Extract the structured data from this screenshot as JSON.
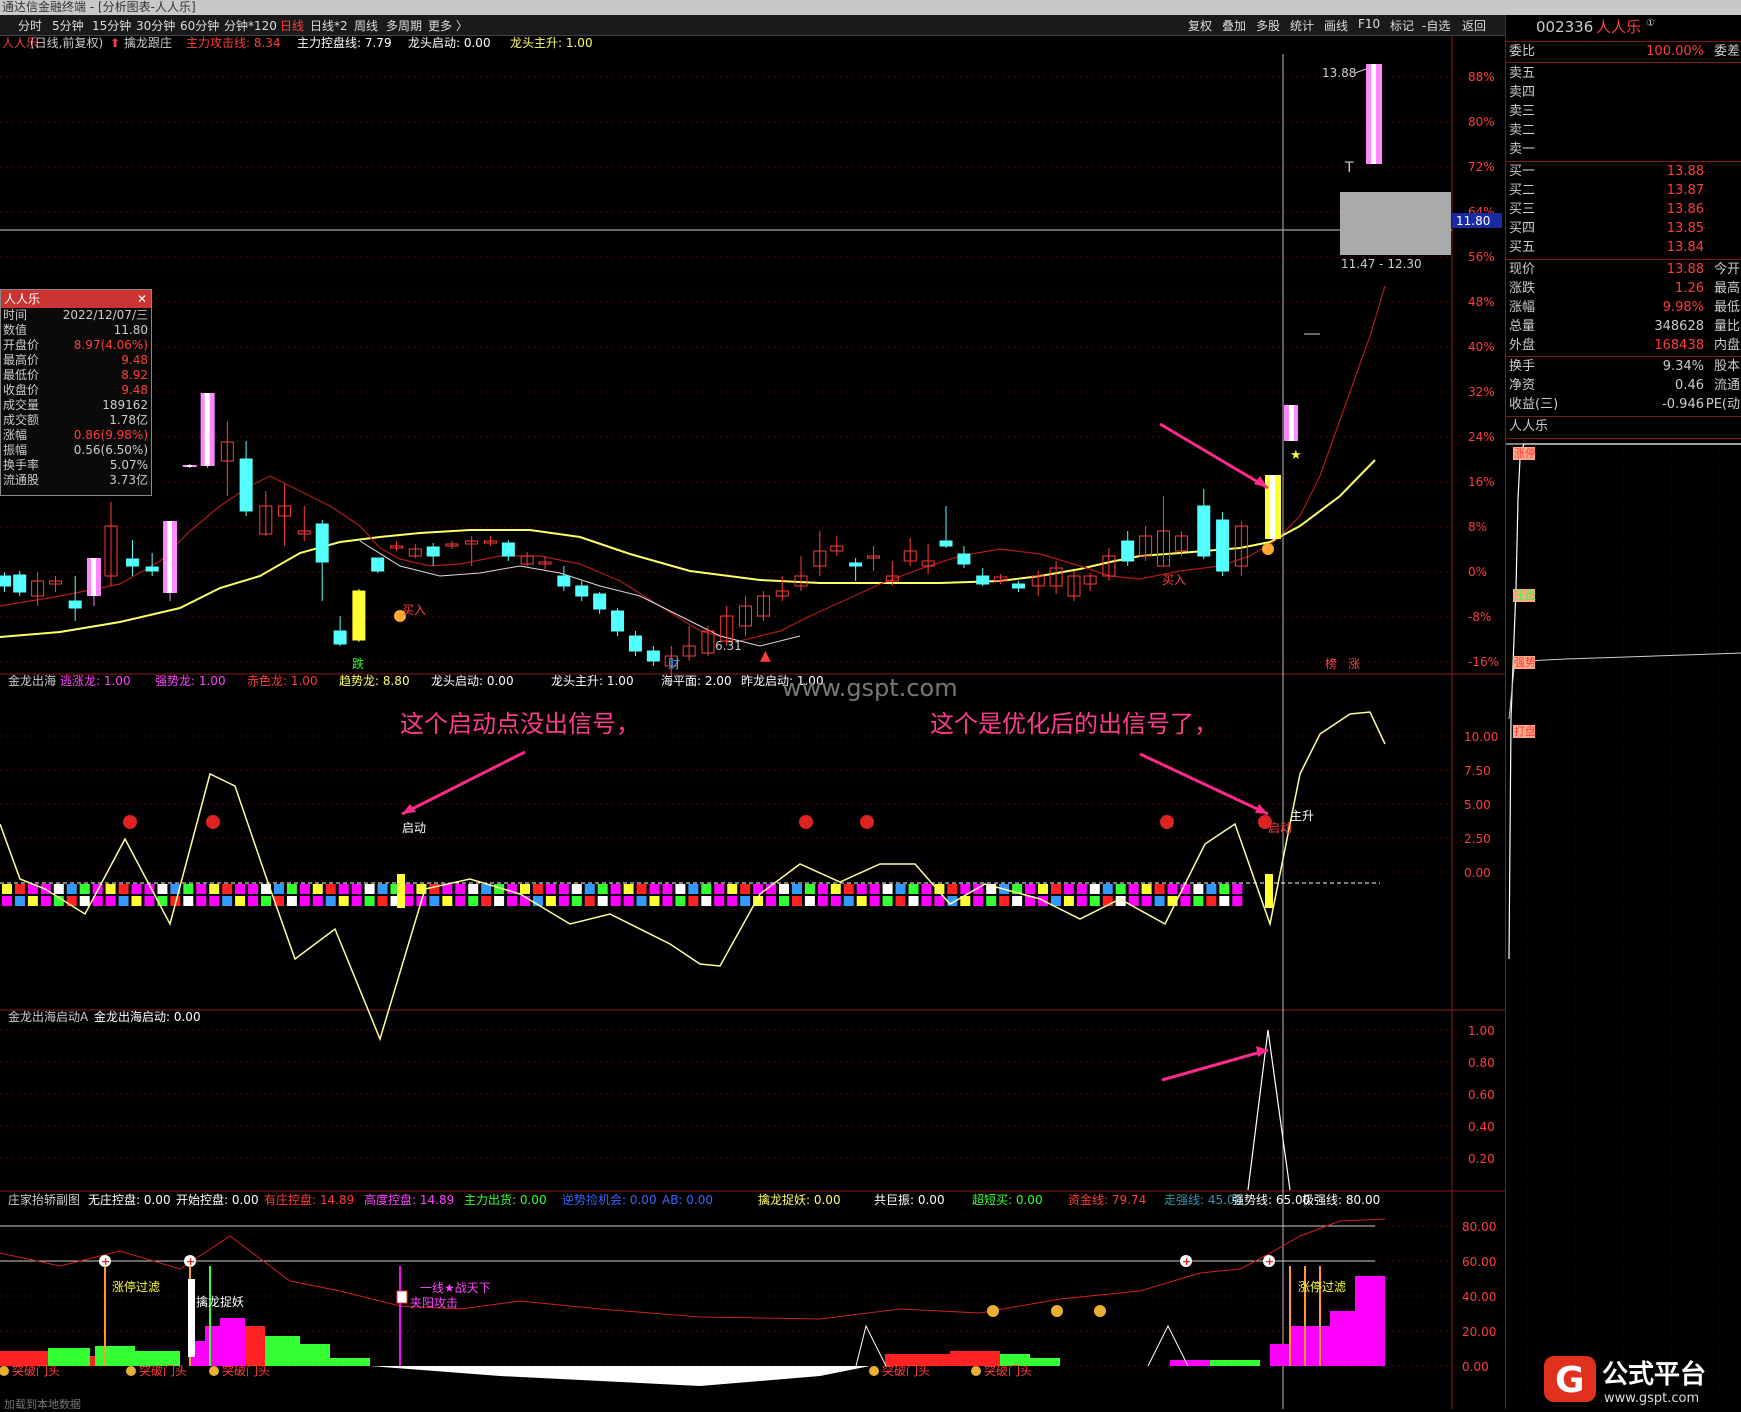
{
  "window": {
    "title": "通达信金融终端 - [分析图表-人人乐]"
  },
  "menu": {
    "periods": [
      "分时",
      "5分钟",
      "15分钟",
      "30分钟",
      "60分钟",
      "分钟*120",
      "日线",
      "日线*2",
      "周线",
      "多周期",
      "更多 〉"
    ],
    "active": "日线",
    "tools": [
      "复权",
      "叠加",
      "多股",
      "统计",
      "画线",
      "F10",
      "标记",
      "-自选",
      "返回"
    ]
  },
  "main_header": {
    "name": "人人乐",
    "mode": "(日线,前复权)",
    "indicator": "擒龙跟庄",
    "items": [
      {
        "label": "主力攻击线: 8.34",
        "color": "#ff3c3c"
      },
      {
        "label": "主力控盘线: 7.79",
        "color": "#ffffff"
      },
      {
        "label": "龙头启动: 0.00",
        "color": "#ffffff"
      },
      {
        "label": "龙头主升: 1.00",
        "color": "#ffff66"
      }
    ]
  },
  "price_axis": [
    "88%",
    "80%",
    "72%",
    "64%",
    "56%",
    "48%",
    "40%",
    "32%",
    "24%",
    "16%",
    "8%",
    "0%",
    "-8%",
    "-16%"
  ],
  "price_marker": "11.80",
  "annotations": {
    "max_price": "13.88",
    "range": "11.47 - 12.30",
    "min_price": "6.31",
    "buy1": "买入",
    "buy2": "买入",
    "bottom_marks": [
      "跌",
      "财",
      "榜",
      "涨"
    ],
    "arrow_left_text": "这个启动点没出信号，",
    "arrow_right_text": "这个是优化后的出信号了，",
    "start_label": "启动",
    "rise_label": "主升",
    "start_label2": "启动",
    "watermark": "www.gspt.com"
  },
  "infobox": {
    "title": "人人乐",
    "rows": [
      {
        "k": "时间",
        "v": "2022/12/07/三",
        "c": "#ccc"
      },
      {
        "k": "数值",
        "v": "11.80",
        "c": "#ccc"
      },
      {
        "k": "开盘价",
        "v": "8.97(4.06%)",
        "c": "#ff3c3c"
      },
      {
        "k": "最高价",
        "v": "9.48",
        "c": "#ff3c3c"
      },
      {
        "k": "最低价",
        "v": "8.92",
        "c": "#ff3c3c"
      },
      {
        "k": "收盘价",
        "v": "9.48",
        "c": "#ff3c3c"
      },
      {
        "k": "成交量",
        "v": "189162",
        "c": "#ccc"
      },
      {
        "k": "成交额",
        "v": "1.78亿",
        "c": "#ccc"
      },
      {
        "k": "涨幅",
        "v": "0.86(9.98%)",
        "c": "#ff3c3c"
      },
      {
        "k": "振幅",
        "v": "0.56(6.50%)",
        "c": "#ccc"
      },
      {
        "k": "换手率",
        "v": "5.07%",
        "c": "#ccc"
      },
      {
        "k": "流通股",
        "v": "3.73亿",
        "c": "#ccc"
      }
    ]
  },
  "panel2": {
    "name": "金龙出海",
    "items": [
      {
        "label": "逃涨龙: 1.00",
        "color": "#ff44ff"
      },
      {
        "label": "强势龙: 1.00",
        "color": "#ff44ff"
      },
      {
        "label": "赤色龙: 1.00",
        "color": "#ff3c3c"
      },
      {
        "label": "趋势龙: 8.80",
        "color": "#ffff66"
      },
      {
        "label": "龙头启动: 0.00",
        "color": "#ffffff"
      },
      {
        "label": "龙头主升: 1.00",
        "color": "#ffffff"
      },
      {
        "label": "海平面: 2.00",
        "color": "#ffffff"
      },
      {
        "label": "昨龙启动: 1.00",
        "color": "#ffffff"
      }
    ],
    "axis": [
      "10.00",
      "7.50",
      "5.00",
      "2.50",
      "0.00"
    ]
  },
  "panel3": {
    "name": "金龙出海启动A",
    "items": [
      {
        "label": "金龙出海启动: 0.00",
        "color": "#ffffff"
      }
    ],
    "axis": [
      "1.00",
      "0.80",
      "0.60",
      "0.40",
      "0.20"
    ]
  },
  "panel4": {
    "name": "庄家抬轿副图",
    "items": [
      {
        "label": "无庄控盘: 0.00",
        "color": "#ffffff"
      },
      {
        "label": "开始控盘: 0.00",
        "color": "#ffffff"
      },
      {
        "label": "有庄控盘: 14.89",
        "color": "#ff3c3c"
      },
      {
        "label": "高度控盘: 14.89",
        "color": "#ff44ff"
      },
      {
        "label": "主力出货: 0.00",
        "color": "#33ff33"
      },
      {
        "label": "逆势捡机会: 0.00",
        "color": "#3366ff"
      },
      {
        "label": "AB: 0.00",
        "color": "#3366ff"
      },
      {
        "label": "擒龙捉妖: 0.00",
        "color": "#ffff66"
      },
      {
        "label": "共巨振: 0.00",
        "color": "#ffffff"
      },
      {
        "label": "超短买: 0.00",
        "color": "#33ff33"
      },
      {
        "label": "资金线: 79.74",
        "color": "#ff3c3c"
      },
      {
        "label": "走强线: 45.00",
        "color": "#3399aa"
      },
      {
        "label": "强势线: 65.00",
        "color": "#ffffff"
      },
      {
        "label": "极强线: 80.00",
        "color": "#ffffff"
      }
    ],
    "axis": [
      "80.00",
      "60.00",
      "40.00",
      "20.00",
      "0.00"
    ],
    "labels": [
      "涨停过滤",
      "擒龙捉妖",
      "一线★战天下",
      "夹阳攻击",
      "涨停过滤",
      "共巨振"
    ],
    "breakout": [
      "突破门头",
      "突破门头",
      "突破门头",
      "突破门头",
      "突破门头"
    ],
    "bottom_note": "加载到本地数据"
  },
  "quote": {
    "code": "002336",
    "name": "人人乐",
    "ratio_label": "委比",
    "ratio_value": "100.00%",
    "diff_label": "委差",
    "asks": [
      {
        "label": "卖五",
        "price": ""
      },
      {
        "label": "卖四",
        "price": ""
      },
      {
        "label": "卖三",
        "price": ""
      },
      {
        "label": "卖二",
        "price": ""
      },
      {
        "label": "卖一",
        "price": ""
      }
    ],
    "bids": [
      {
        "label": "买一",
        "price": "13.88"
      },
      {
        "label": "买二",
        "price": "13.87"
      },
      {
        "label": "买三",
        "price": "13.86"
      },
      {
        "label": "买四",
        "price": "13.85"
      },
      {
        "label": "买五",
        "price": "13.84"
      }
    ],
    "stats": [
      {
        "l": "现价",
        "v": "13.88",
        "c": "#ff3c3c",
        "r": "今开"
      },
      {
        "l": "涨跌",
        "v": "1.26",
        "c": "#ff3c3c",
        "r": "最高"
      },
      {
        "l": "涨幅",
        "v": "9.98%",
        "c": "#ff3c3c",
        "r": "最低"
      },
      {
        "l": "总量",
        "v": "348628",
        "c": "#ccc",
        "r": "量比"
      },
      {
        "l": "外盘",
        "v": "168438",
        "c": "#ff3c3c",
        "r": "内盘"
      }
    ],
    "stats2": [
      {
        "l": "换手",
        "v": "9.34%",
        "c": "#ccc",
        "r": "股本"
      },
      {
        "l": "净资",
        "v": "0.46",
        "c": "#ccc",
        "r": "流通"
      },
      {
        "l": "收益(三)",
        "v": "-0.946",
        "c": "#ccc",
        "r": "PE(动"
      }
    ],
    "mini_title": "人人乐",
    "mini_tags": [
      "涨停",
      "压盘",
      "强势",
      "打盘"
    ]
  },
  "logo": {
    "text": "公式平台",
    "url": "www.gspt.com"
  },
  "colors": {
    "up": "#ff3c3c",
    "down": "#54ffff",
    "grid": "#5a0000",
    "ma": "#ffff66"
  }
}
